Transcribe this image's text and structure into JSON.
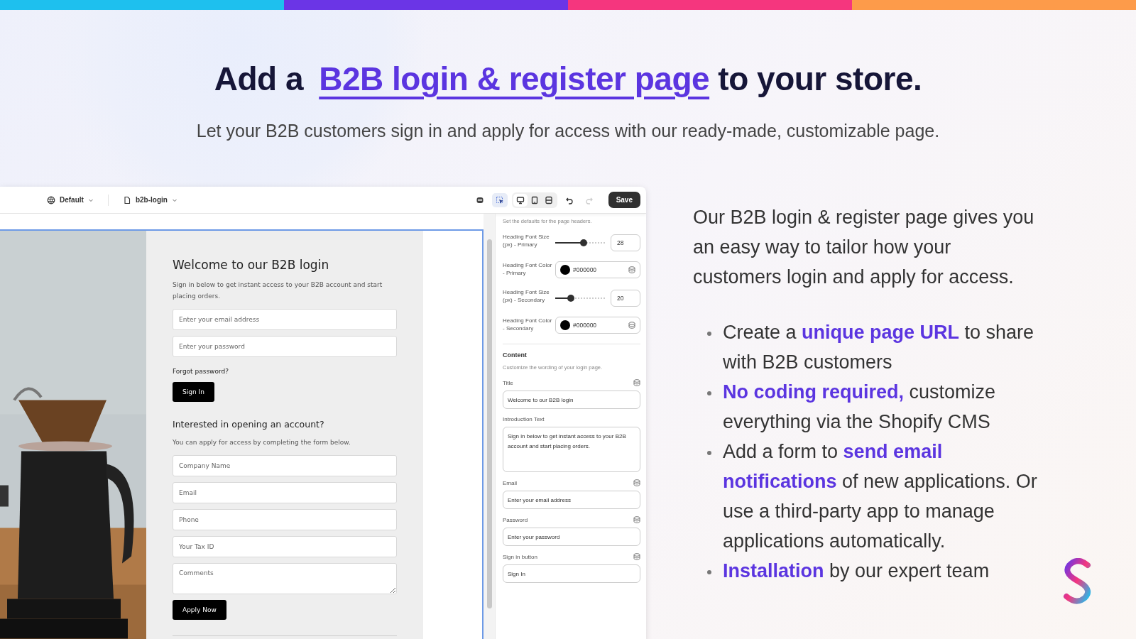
{
  "headline": {
    "before": "Add a ",
    "highlight": "B2B login & register page",
    "after": " to your store."
  },
  "subtitle": "Let your B2B customers sign in and apply for access with our ready-made, customizable page.",
  "editor": {
    "toolbar": {
      "theme": "Default",
      "page": "b2b-login",
      "inspect": {
        "selected": true
      },
      "devices": [
        {
          "kind": "desktop",
          "selected": true
        },
        {
          "kind": "tablet",
          "selected": false
        },
        {
          "kind": "fullwidth",
          "selected": false
        }
      ],
      "history": [
        {
          "kind": "undo",
          "disabled": false
        },
        {
          "kind": "redo",
          "disabled": true
        }
      ],
      "save": "Save"
    },
    "preview": {
      "login_title": "Welcome to our B2B login",
      "login_intro": "Sign in below to get instant access to your B2B account and start placing orders.",
      "login_fields": [
        {
          "kind": "input",
          "placeholder": "Enter your email address"
        },
        {
          "kind": "input",
          "placeholder": "Enter your password"
        }
      ],
      "forgot_link": "Forgot password?",
      "sign_in_button": "Sign In",
      "apply_title": "Interested in opening an account?",
      "apply_intro": "You can apply for access by completing the form below.",
      "apply_fields": [
        {
          "kind": "input",
          "placeholder": "Company Name"
        },
        {
          "kind": "input",
          "placeholder": "Email"
        },
        {
          "kind": "input",
          "placeholder": "Phone"
        },
        {
          "kind": "input",
          "placeholder": "Your Tax ID"
        },
        {
          "kind": "textarea",
          "placeholder": "Comments"
        }
      ],
      "apply_button": "Apply Now"
    },
    "settings": {
      "note": "Set the defaults for the page headers.",
      "header_settings": [
        {
          "kind": "slider",
          "label": "Heading Font Size (px) - Primary",
          "level": 0.57,
          "value": "28"
        },
        {
          "kind": "color",
          "label": "Heading Font Color - Primary",
          "value": "#000000",
          "linked": true
        },
        {
          "kind": "slider",
          "label": "Heading Font Size (px) - Secondary",
          "level": 0.31,
          "value": "20"
        },
        {
          "kind": "color",
          "label": "Heading Font Color - Secondary",
          "value": "#000000",
          "linked": true
        }
      ],
      "content_title": "Content",
      "content_note": "Customize the wording of your login page.",
      "content_fields": [
        {
          "kind": "text",
          "label": "Title",
          "value": "Welcome to our B2B login",
          "linked": true
        },
        {
          "kind": "textarea",
          "label": "Introduction Text",
          "value": "Sign in below to get instant access to your B2B account and start placing orders.",
          "linked": false
        },
        {
          "kind": "text",
          "label": "Email",
          "value": "Enter your email address",
          "linked": true
        },
        {
          "kind": "text",
          "label": "Password",
          "value": "Enter your password",
          "linked": true
        },
        {
          "kind": "text",
          "label": "Sign in button",
          "value": "Sign In",
          "linked": true
        }
      ]
    }
  },
  "description": "Our B2B login & register page gives you an easy way to tailor how your customers login and apply for access.",
  "features": [
    "Create a **unique page URL** to share with B2B customers",
    "**No coding required,** customize everything via the Shopify CMS",
    "Add a form to **send email notifications** of new applications. Or use a third-party app to manage applications automatically.",
    "**Installation** by our expert team"
  ]
}
